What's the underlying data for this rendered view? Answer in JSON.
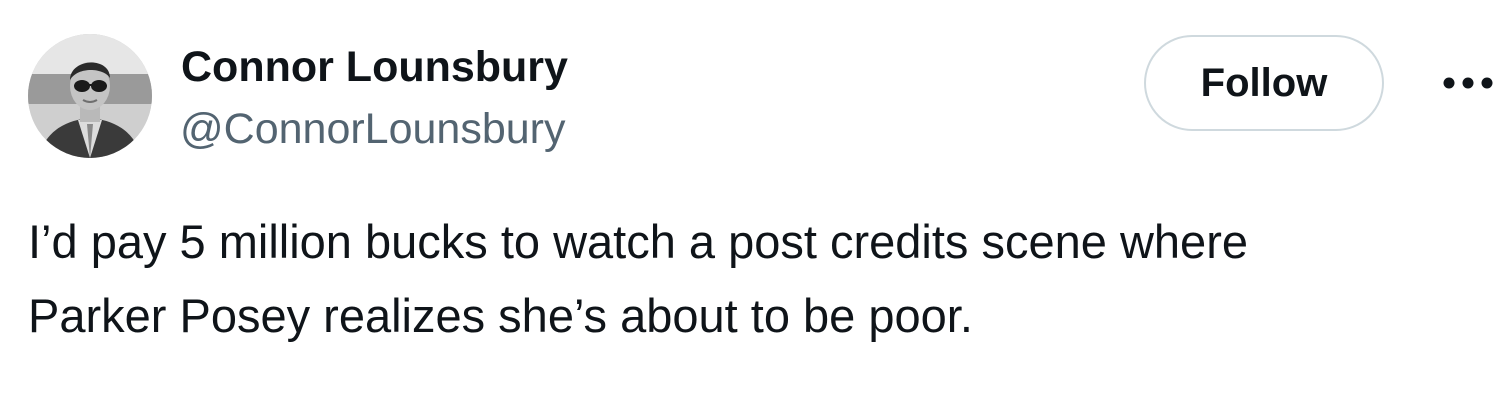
{
  "author": {
    "display_name": "Connor Lounsbury",
    "handle": "@ConnorLounsbury",
    "avatar_icon": "profile-photo"
  },
  "actions": {
    "follow_label": "Follow",
    "more_icon": "more-horizontal-icon"
  },
  "tweet": {
    "lines": [
      "I’d pay 5 million bucks to watch a post credits scene where",
      "Parker Posey realizes she’s about to be poor."
    ]
  },
  "colors": {
    "text_primary": "#0f1419",
    "text_secondary": "#536471",
    "button_border": "#cfd9de"
  }
}
